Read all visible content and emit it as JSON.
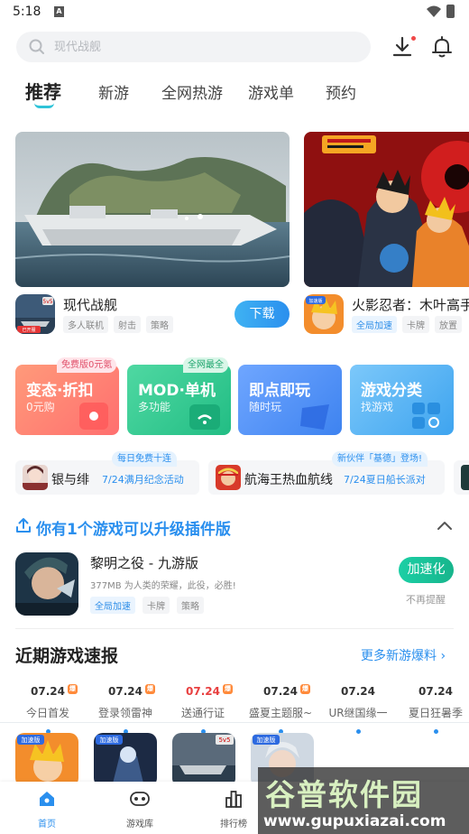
{
  "status_bar": {
    "time": "5:18",
    "notification_icon": "A"
  },
  "search": {
    "placeholder": "现代战舰"
  },
  "tabs": [
    {
      "label": "推荐",
      "active": true
    },
    {
      "label": "新游"
    },
    {
      "label": "全网热游"
    },
    {
      "label": "游戏单"
    },
    {
      "label": "预约"
    }
  ],
  "featured": [
    {
      "name": "现代战舰",
      "tags": [
        "多人联机",
        "射击",
        "策略"
      ],
      "action": "下载"
    },
    {
      "name": "火影忍者：木叶高手",
      "tags": [
        "全局加速",
        "卡牌",
        "放置"
      ]
    }
  ],
  "categories": [
    {
      "title": "变态·折扣",
      "subtitle": "0元购",
      "badge": "免费版0元氪",
      "color": "#ff7a6a"
    },
    {
      "title": "MOD·单机",
      "subtitle": "多功能",
      "badge": "全网最全",
      "color": "#34c98c"
    },
    {
      "title": "即点即玩",
      "subtitle": "随时玩",
      "color": "#4a8ff0"
    },
    {
      "title": "游戏分类",
      "subtitle": "找游戏",
      "color": "#4fb4f2"
    }
  ],
  "activities": [
    {
      "title": "银与绯",
      "subtitle": "7/24满月纪念活动",
      "badge": "每日免费十连"
    },
    {
      "title": "航海王热血航线",
      "subtitle": "7/24夏日船长派对",
      "badge": "新伙伴「基德」登场!"
    }
  ],
  "upgrade": {
    "title": "你有1个游戏可以升级插件版",
    "game": {
      "name": "黎明之役 - 九游版",
      "desc": "377MB  为人类的荣耀，此役，必胜!",
      "tags": [
        "全局加速",
        "卡牌",
        "策略"
      ],
      "action": "加速化",
      "dismiss": "不再提醒"
    }
  },
  "news": {
    "title": "近期游戏速报",
    "more": "更多新游爆料",
    "items": [
      {
        "date": "07.24",
        "label": "今日首发",
        "hot": true
      },
      {
        "date": "07.24",
        "label": "登录领雷神",
        "hot": true
      },
      {
        "date": "07.24",
        "label": "送通行证",
        "hot": true,
        "red": true
      },
      {
        "date": "07.24",
        "label": "盛夏主题服~",
        "hot": true
      },
      {
        "date": "07.24",
        "label": "UR继国缘一"
      },
      {
        "date": "07.24",
        "label": "夏日狂暑季"
      }
    ],
    "badge_text": "爆"
  },
  "bottom_nav": [
    {
      "label": "首页",
      "icon": "home-icon",
      "active": true
    },
    {
      "label": "游戏库",
      "icon": "gamepad-icon"
    },
    {
      "label": "排行榜",
      "icon": "ranking-icon"
    }
  ],
  "game_badges": {
    "accel": "加速版",
    "fivevfive": "5v5",
    "launched": "已开服"
  },
  "watermark": {
    "title": "谷普软件园",
    "url": "www.gupuxiazai.com"
  },
  "colors": {
    "accent": "#2a8fee",
    "tab_indicator": "#2ec3d8",
    "download": "#3fa2f0",
    "accelerate": "#1ccfa5"
  }
}
